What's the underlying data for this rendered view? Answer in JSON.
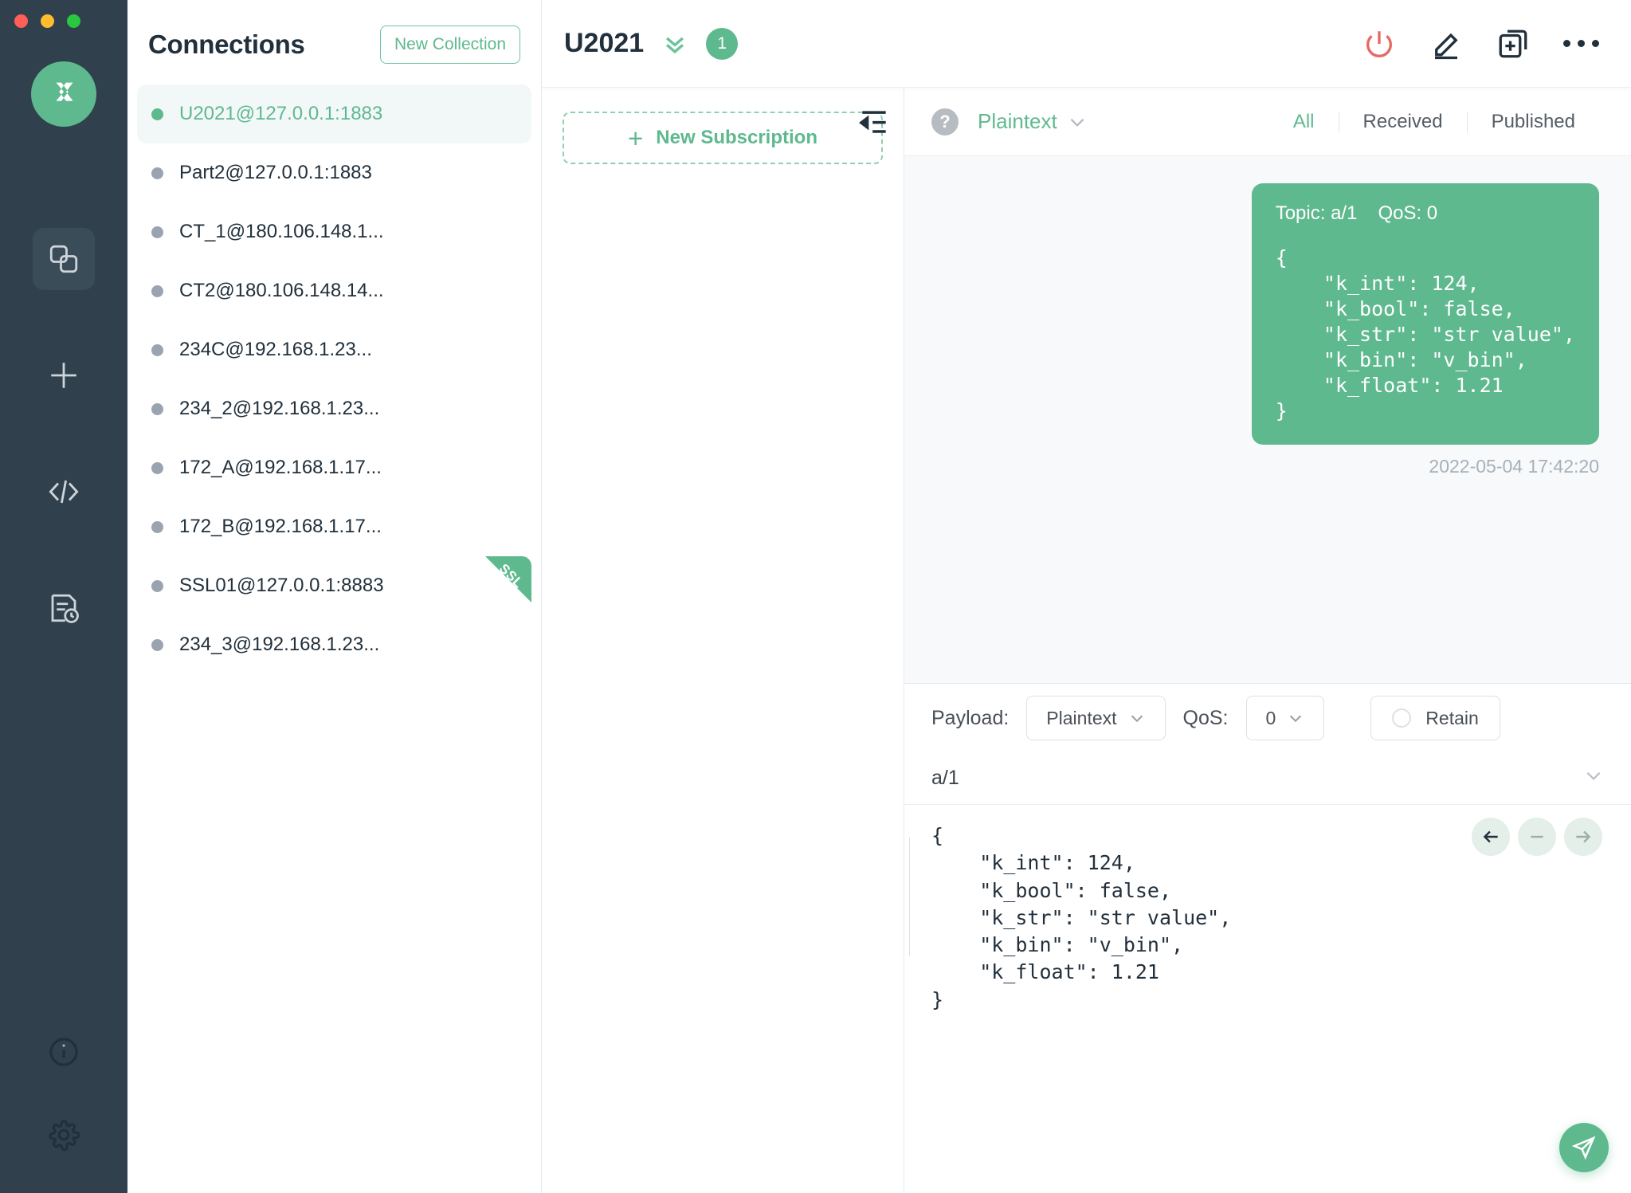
{
  "window": {
    "traffic_lights": [
      "close",
      "minimize",
      "maximize"
    ],
    "logo": "mqttx-logo"
  },
  "rail": {
    "items": [
      {
        "name": "connections",
        "icon": "copy-squares-icon",
        "active": true
      },
      {
        "name": "new",
        "icon": "plus-icon",
        "active": false
      },
      {
        "name": "scripts",
        "icon": "code-brackets-icon",
        "active": false
      },
      {
        "name": "log",
        "icon": "log-clock-icon",
        "active": false
      }
    ],
    "bottom_items": [
      {
        "name": "about",
        "icon": "info-circle-icon"
      },
      {
        "name": "settings",
        "icon": "gear-icon"
      }
    ]
  },
  "connections_panel": {
    "title": "Connections",
    "new_collection_label": "New Collection",
    "items": [
      {
        "label": "U2021@127.0.0.1:1883",
        "selected": true,
        "ssl": false
      },
      {
        "label": "Part2@127.0.0.1:1883",
        "selected": false,
        "ssl": false
      },
      {
        "label": "CT_1@180.106.148.1...",
        "selected": false,
        "ssl": false
      },
      {
        "label": "CT2@180.106.148.14...",
        "selected": false,
        "ssl": false
      },
      {
        "label": "234C@192.168.1.23...",
        "selected": false,
        "ssl": false
      },
      {
        "label": "234_2@192.168.1.23...",
        "selected": false,
        "ssl": false
      },
      {
        "label": "172_A@192.168.1.17...",
        "selected": false,
        "ssl": false
      },
      {
        "label": "172_B@192.168.1.17...",
        "selected": false,
        "ssl": false
      },
      {
        "label": "SSL01@127.0.0.1:8883",
        "selected": false,
        "ssl": true,
        "ssl_label": "SSL"
      },
      {
        "label": "234_3@192.168.1.23...",
        "selected": false,
        "ssl": false
      }
    ]
  },
  "topbar": {
    "title": "U2021",
    "chevron_icon": "double-chevron-down-icon",
    "badge_count": "1",
    "actions": [
      {
        "name": "disconnect",
        "icon": "power-icon",
        "color": "#e66a63"
      },
      {
        "name": "edit",
        "icon": "pencil-icon"
      },
      {
        "name": "duplicate",
        "icon": "copy-plus-icon"
      },
      {
        "name": "more",
        "icon": "ellipsis-icon"
      }
    ]
  },
  "subscriptions": {
    "new_subscription_label": "New Subscription",
    "plus_glyph": "+",
    "collapse_icon": "collapse-left-icon"
  },
  "messages_toolbar": {
    "help_glyph": "?",
    "format": "Plaintext",
    "format_chevron": "chevron-down-icon",
    "filters": [
      {
        "label": "All",
        "active": true
      },
      {
        "label": "Received",
        "active": false
      },
      {
        "label": "Published",
        "active": false
      }
    ]
  },
  "messages": [
    {
      "topic_label": "Topic: a/1",
      "qos_label": "QoS: 0",
      "payload": "{\n    \"k_int\": 124,\n    \"k_bool\": false,\n    \"k_str\": \"str value\",\n    \"k_bin\": \"v_bin\",\n    \"k_float\": 1.21\n}",
      "time": "2022-05-04 17:42:20",
      "direction": "published"
    }
  ],
  "publish": {
    "payload_label": "Payload:",
    "payload_format": "Plaintext",
    "qos_label": "QoS:",
    "qos_value": "0",
    "retain_label": "Retain",
    "retain_checked": false,
    "topic": "a/1",
    "topic_chevron": "chevron-down-icon",
    "editor_content": "{\n    \"k_int\": 124,\n    \"k_bool\": false,\n    \"k_str\": \"str value\",\n    \"k_bin\": \"v_bin\",\n    \"k_float\": 1.21\n}",
    "nav_buttons": [
      {
        "name": "prev",
        "icon": "arrow-left-icon",
        "emphasis": "dark"
      },
      {
        "name": "clear",
        "icon": "minus-icon",
        "emphasis": "light"
      },
      {
        "name": "next",
        "icon": "arrow-right-icon",
        "emphasis": "light"
      }
    ],
    "send_icon": "send-paper-plane-icon"
  },
  "colors": {
    "brand_green": "#5fb98f",
    "rail_dark": "#30404d",
    "danger_red": "#e66a63",
    "msg_bg": "#f7f9fb"
  }
}
